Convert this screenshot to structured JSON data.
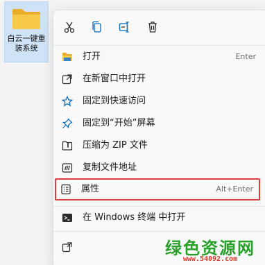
{
  "desktop": {
    "folder_label": "白云一键重装系统"
  },
  "quick_actions": [
    {
      "icon": "scissors-icon",
      "name": "cut-button"
    },
    {
      "icon": "copy-icon",
      "name": "copy-button"
    },
    {
      "icon": "rename-icon",
      "name": "rename-button"
    },
    {
      "icon": "trash-icon",
      "name": "delete-button"
    }
  ],
  "menu": {
    "items": [
      {
        "label": "打开",
        "shortcut": "Enter",
        "icon": "folder-icon"
      },
      {
        "label": "在新窗口中打开",
        "shortcut": "",
        "icon": "open-new-window-icon"
      },
      {
        "label": "固定到快速访问",
        "shortcut": "",
        "icon": "star-icon"
      },
      {
        "label": "固定到“开始”屏幕",
        "shortcut": "",
        "icon": "pin-icon"
      },
      {
        "label": "压缩为 ZIP 文件",
        "shortcut": "",
        "icon": "zip-icon"
      },
      {
        "label": "复制文件地址",
        "shortcut": "",
        "icon": "copy-path-icon"
      },
      {
        "label": "属性",
        "shortcut": "Alt+Enter",
        "icon": "properties-icon"
      },
      {
        "label": "在 Windows 终端 中打开",
        "shortcut": "",
        "icon": "terminal-icon"
      },
      {
        "label": "",
        "shortcut": "",
        "icon": "more-options-icon"
      }
    ],
    "highlight_color": "#e03a3a"
  },
  "watermark": {
    "title": "绿色资源网",
    "url": "www.54092.com"
  },
  "colors": {
    "accent": "#0067c0",
    "folder": "#f3c242",
    "watermark_green": "#27a12a",
    "watermark_red": "#d93a2b"
  }
}
